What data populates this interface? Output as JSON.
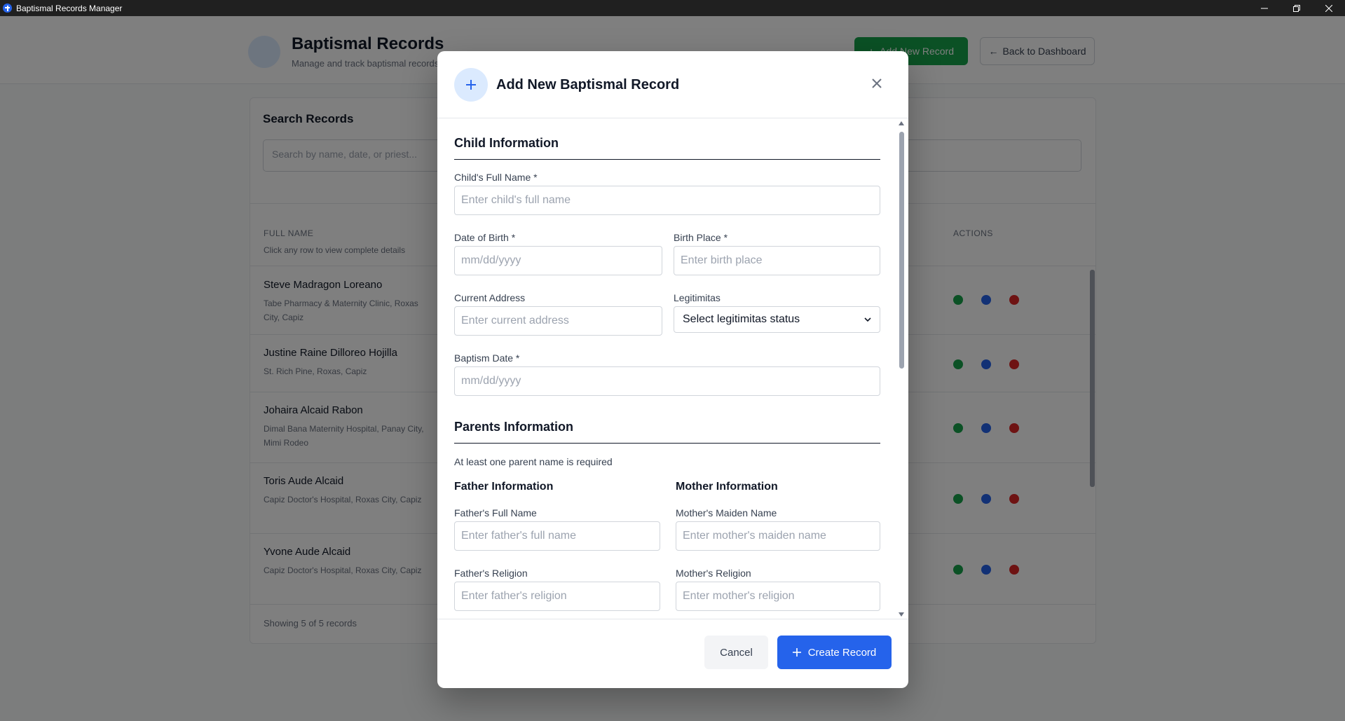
{
  "window": {
    "title": "Baptismal Records Manager"
  },
  "background": {
    "title": "Baptismal Records",
    "subtitle": "Manage and track baptismal records",
    "add_button": "Add New Record",
    "back_button": "Back to Dashboard",
    "search_title": "Search Records",
    "search_placeholder": "Search by name, date, or priest...",
    "col_name": "FULL NAME",
    "col_hint": "Click any row to view complete details",
    "col_actions": "ACTIONS",
    "rows": [
      {
        "name": "Steve Madragon Loreano",
        "place": "Tabe Pharmacy & Maternity Clinic, Roxas City, Capiz"
      },
      {
        "name": "Justine Raine Dilloreo Hojilla",
        "place": "St. Rich Pine, Roxas, Capiz"
      },
      {
        "name": "Johaira Alcaid Rabon",
        "place": "Dimal Bana Maternity Hospital, Panay City, Mimi Rodeo"
      },
      {
        "name": "Toris Aude Alcaid",
        "place": "Capiz Doctor's Hospital, Roxas City, Capiz"
      },
      {
        "name": "Yvone Aude Alcaid",
        "place": "Capiz Doctor's Hospital, Roxas City, Capiz"
      }
    ],
    "footer": "Showing 5 of 5 records"
  },
  "modal": {
    "title": "Add New Baptismal Record",
    "child_section": "Child Information",
    "child_name_label": "Child's Full Name *",
    "child_name_placeholder": "Enter child's full name",
    "dob_label": "Date of Birth *",
    "dob_placeholder": "mm/dd/yyyy",
    "birthplace_label": "Birth Place *",
    "birthplace_placeholder": "Enter birth place",
    "address_label": "Current Address",
    "address_placeholder": "Enter current address",
    "legit_label": "Legitimitas",
    "legit_value": "Select legitimitas status",
    "baptism_label": "Baptism Date *",
    "baptism_placeholder": "mm/dd/yyyy",
    "parents_section": "Parents Information",
    "parents_note": "At least one parent name is required",
    "father_head": "Father Information",
    "mother_head": "Mother Information",
    "father_name_label": "Father's Full Name",
    "father_name_placeholder": "Enter father's full name",
    "mother_name_label": "Mother's Maiden Name",
    "mother_name_placeholder": "Enter mother's maiden name",
    "father_religion_label": "Father's Religion",
    "father_religion_placeholder": "Enter father's religion",
    "mother_religion_label": "Mother's Religion",
    "mother_religion_placeholder": "Enter mother's religion",
    "cancel": "Cancel",
    "create": "Create Record"
  },
  "colors": {
    "primary": "#2563eb",
    "success": "#16a34a",
    "danger": "#dc2626"
  }
}
